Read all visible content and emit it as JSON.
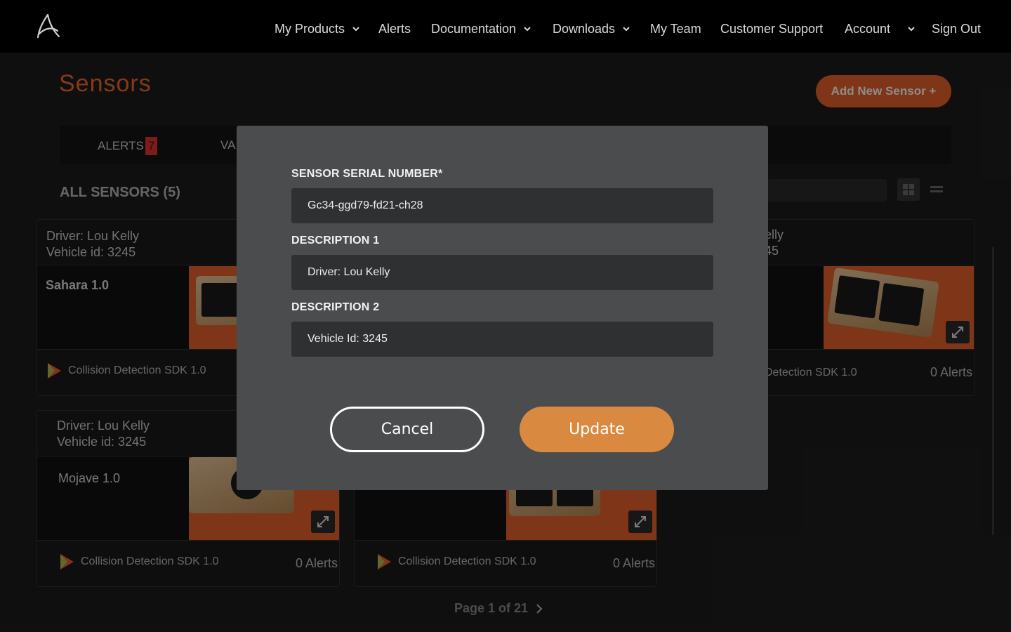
{
  "nav": {
    "items": [
      {
        "label": "My Products",
        "dropdown": true
      },
      {
        "label": "Alerts",
        "dropdown": false
      },
      {
        "label": "Documentation",
        "dropdown": true
      },
      {
        "label": "Downloads",
        "dropdown": true
      },
      {
        "label": "My Team",
        "dropdown": false
      },
      {
        "label": "Customer Support",
        "dropdown": false
      },
      {
        "label": "Account",
        "dropdown": true
      },
      {
        "label": "Sign Out",
        "dropdown": false
      }
    ]
  },
  "page": {
    "title": "Sensors",
    "add_button": "Add New Sensor +",
    "tabs": {
      "alerts_label": "ALERTS",
      "alerts_count": "7",
      "second_tab_partial": "VA"
    },
    "all_sensors_label": "ALL SENSORS (5)",
    "pager_label": "Page 1 of 21"
  },
  "cards": [
    {
      "driver": "Driver: Lou Kelly",
      "vehicle": "Vehicle id: 3245",
      "model": "Sahara 1.0",
      "sdk": "Collision Detection SDK 1.0",
      "alerts": ""
    },
    {
      "driver": "elly",
      "vehicle": "45",
      "model": "",
      "sdk": "Detection SDK 1.0",
      "alerts": "0 Alerts"
    },
    {
      "driver": "Driver: Lou Kelly",
      "vehicle": "Vehicle id: 3245",
      "model": "Mojave 1.0",
      "sdk": "Collision Detection SDK 1.0",
      "alerts": "0 Alerts"
    },
    {
      "driver": "",
      "vehicle": "",
      "model": "",
      "sdk": "Collision Detection SDK 1.0",
      "alerts": "0 Alerts"
    }
  ],
  "modal": {
    "serial_label": "SENSOR SERIAL NUMBER*",
    "serial_value": "Gc34-ggd79-fd21-ch28",
    "desc1_label": "DESCRIPTION 1",
    "desc1_value": "Driver: Lou Kelly",
    "desc2_label": "DESCRIPTION 2",
    "desc2_value": "Vehicle Id: 3245",
    "cancel_label": "Cancel",
    "update_label": "Update"
  },
  "colors": {
    "accent_orange": "#e8612b",
    "update_button": "#d98a40",
    "alert_badge": "#e3342f",
    "modal_bg": "#4b4c4d",
    "nav_bg": "#000000"
  }
}
